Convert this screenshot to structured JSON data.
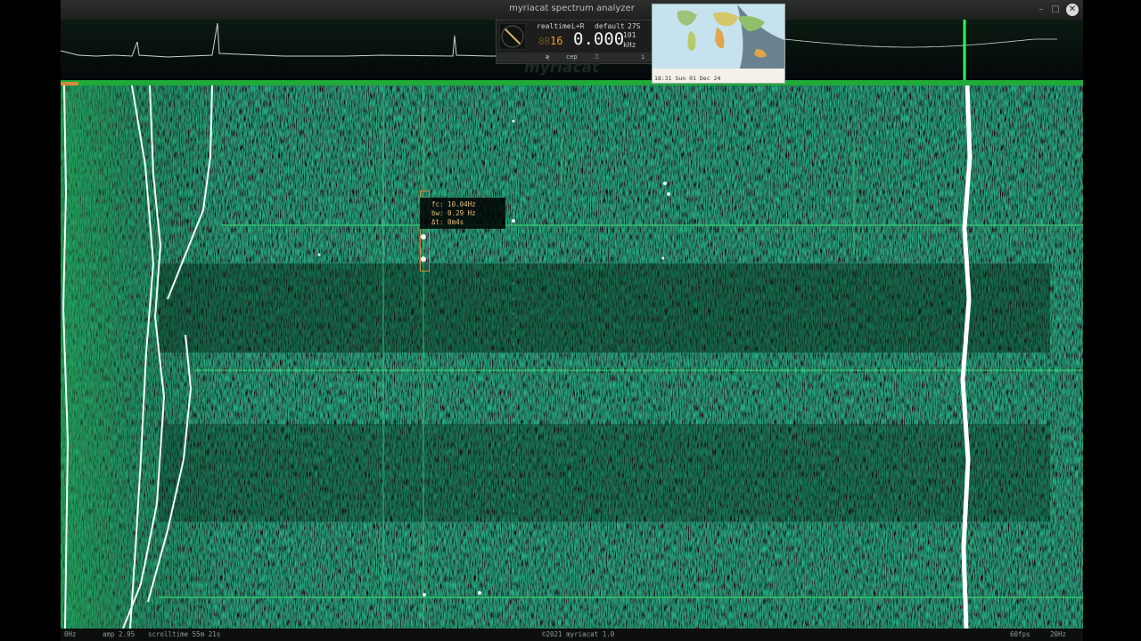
{
  "window": {
    "title": "myriacat spectrum analyzer",
    "controls": [
      "–",
      "□",
      "✕"
    ]
  },
  "widget": {
    "mode": "realtime",
    "channel": "L+R",
    "preset": "default",
    "count": "27S",
    "digit_left": "8B",
    "digit_gain": "16",
    "frequency": "0.000",
    "freq_unit_top": "101",
    "freq_unit": "kHz",
    "buttons": [
      "≷",
      "cep",
      "⎍",
      "i"
    ]
  },
  "logo": "myriacat",
  "map": {
    "clock": "18:31 Sun 01 Dec 24"
  },
  "tooltip": {
    "fc": "fc: 10.04Hz",
    "bw": "bw: 0.29 Hz",
    "dt": "Δt: 0m4s"
  },
  "status": {
    "left_freq": "0Hz",
    "amp": "amp 2.95",
    "scroll": "scrolltime 55m 21s",
    "copyright": "©2021 myriacat 1.0",
    "fps": "60fps",
    "right_freq": "20Hz"
  },
  "colors": {
    "waterfall_base": "#0a3a1d",
    "signal_bright": "#ffffff",
    "accent_green": "#2bff5a",
    "marker_orange": "#d58a3a"
  },
  "icons": {
    "dial": "analog-dial-icon",
    "close": "close-icon"
  }
}
